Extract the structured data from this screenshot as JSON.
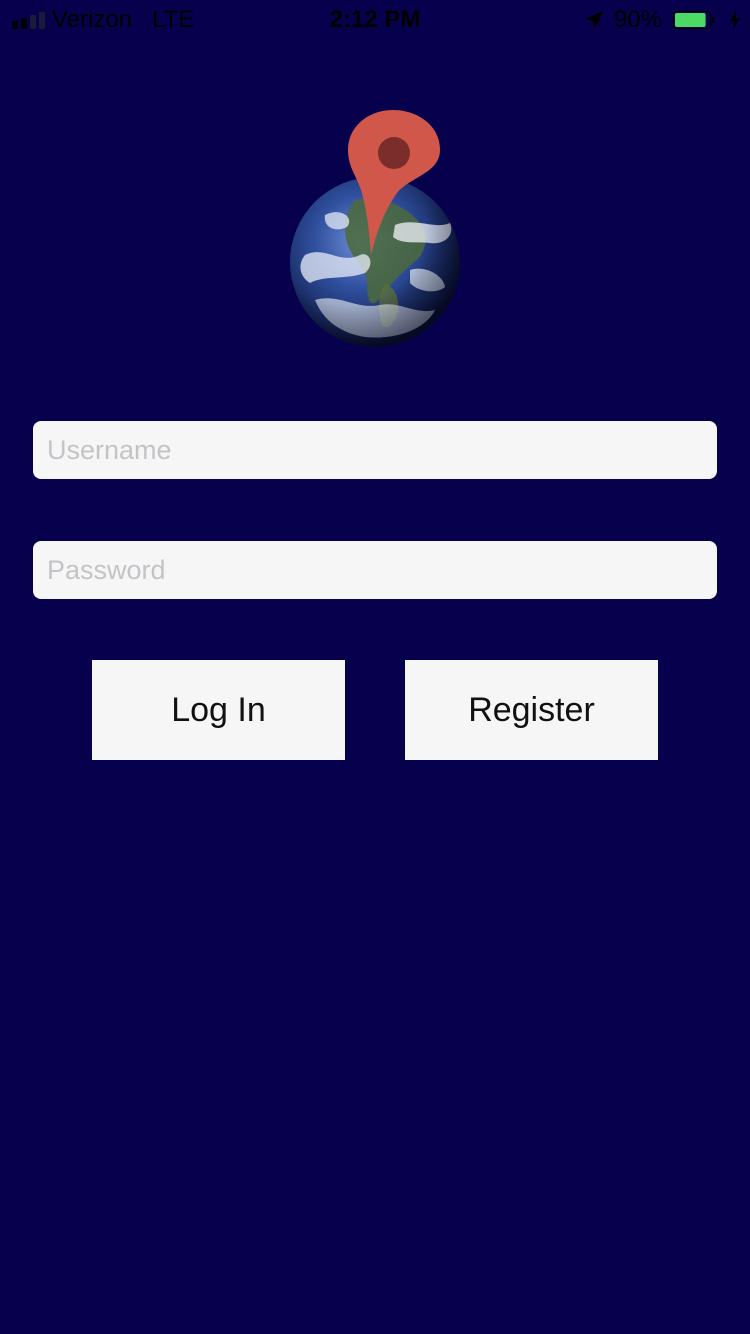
{
  "status_bar": {
    "carrier": "Verizon",
    "network": "LTE",
    "time": "2:12 PM",
    "battery_percent": "90%",
    "battery_level": 0.9,
    "signal_bars_filled": 2,
    "signal_bars_total": 4,
    "icons": [
      "signal-bars-icon",
      "location-arrow-icon",
      "battery-icon",
      "charging-bolt-icon"
    ]
  },
  "logo": {
    "icon": "globe-with-map-pin-icon"
  },
  "login_form": {
    "username_placeholder": "Username",
    "username_value": "",
    "password_placeholder": "Password",
    "password_value": "",
    "login_label": "Log In",
    "register_label": "Register"
  },
  "colors": {
    "background": "#07004d",
    "field_background": "#f6f6f6",
    "button_background": "#f6f6f6",
    "pin": "#d0574a",
    "battery_fill": "#4cd964"
  }
}
